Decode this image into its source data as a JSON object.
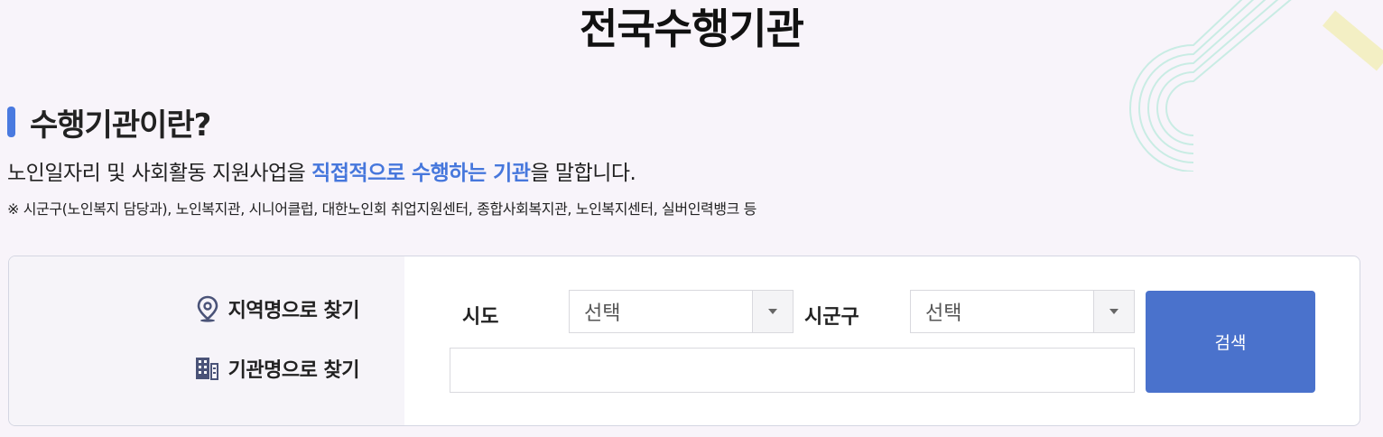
{
  "page": {
    "title": "전국수행기관"
  },
  "section": {
    "title": "수행기관이란?",
    "desc_prefix": "노인일자리 및 사회활동 지원사업을 ",
    "desc_highlight": "직접적으로 수행하는 기관",
    "desc_suffix": "을 말합니다.",
    "note": "※ 시군구(노인복지 담당과), 노인복지관, 시니어클럽, 대한노인회 취업지원센터, 종합사회복지관, 노인복지센터, 실버인력뱅크 등"
  },
  "search": {
    "region_mode_label": "지역명으로 찾기",
    "org_mode_label": "기관명으로 찾기",
    "sido_label": "시도",
    "sido_value": "선택",
    "sigungu_label": "시군구",
    "sigungu_value": "선택",
    "org_name_value": "",
    "button_label": "검색",
    "region_icon": "location-pin-icon",
    "org_icon": "building-icon"
  },
  "colors": {
    "accent": "#4a7ae0",
    "highlight_text": "#4677dc",
    "button": "#4a72cc",
    "background": "#f8f4fa"
  }
}
